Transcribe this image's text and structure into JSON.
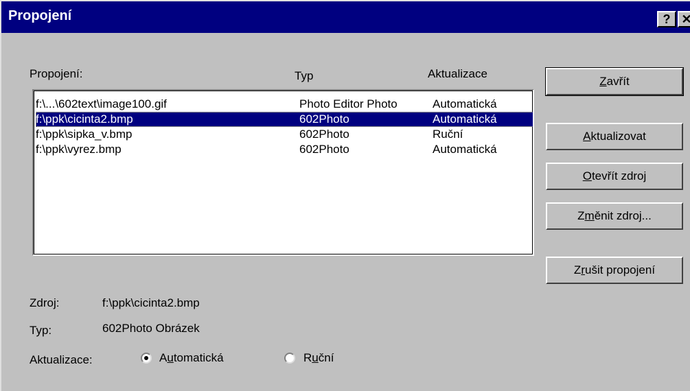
{
  "window": {
    "title": "Propojení",
    "help_glyph": "?",
    "close_glyph": "✕"
  },
  "list": {
    "label": "Propojení:",
    "columns": {
      "link": "Propojení:",
      "type": "Typ",
      "update": "Aktualizace"
    },
    "rows": [
      {
        "link": "f:\\...\\602text\\image100.gif",
        "type": "Photo Editor Photo",
        "update": "Automatická",
        "selected": false
      },
      {
        "link": "f:\\ppk\\cicinta2.bmp",
        "type": "602Photo",
        "update": "Automatická",
        "selected": true
      },
      {
        "link": "f:\\ppk\\sipka_v.bmp",
        "type": "602Photo",
        "update": "Ruční",
        "selected": false
      },
      {
        "link": "f:\\ppk\\vyrez.bmp",
        "type": "602Photo",
        "update": "Automatická",
        "selected": false
      }
    ]
  },
  "buttons": {
    "close": {
      "label": "Zavřít",
      "accel": "Z",
      "rest": "avřít"
    },
    "update": {
      "label": "Aktualizovat",
      "accel": "A",
      "rest": "ktualizovat"
    },
    "open_source": {
      "label": "Otevřít zdroj",
      "accel": "O",
      "rest": "tevřít zdroj"
    },
    "change_source": {
      "label": "Změnit zdroj...",
      "pre": "Z",
      "accel": "m",
      "rest": "ěnit zdroj..."
    },
    "break_link": {
      "label": "Zrušit propojení",
      "pre": "Z",
      "accel": "r",
      "rest": "ušit propojení"
    }
  },
  "details": {
    "source_label": "Zdroj:",
    "source_value": "f:\\ppk\\cicinta2.bmp",
    "type_label": "Typ:",
    "type_value": "602Photo Obrázek",
    "update_label": "Aktualizace:",
    "radio_auto": {
      "label": "Automatická",
      "pre": "A",
      "accel": "u",
      "rest": "tomatická",
      "checked": true
    },
    "radio_manual": {
      "label": "Ruční",
      "pre": "R",
      "accel": "u",
      "rest": "ční",
      "checked": false
    }
  },
  "colors": {
    "titlebar": "#000080",
    "dialog_bg": "#c0c0c0",
    "selection": "#000080"
  }
}
